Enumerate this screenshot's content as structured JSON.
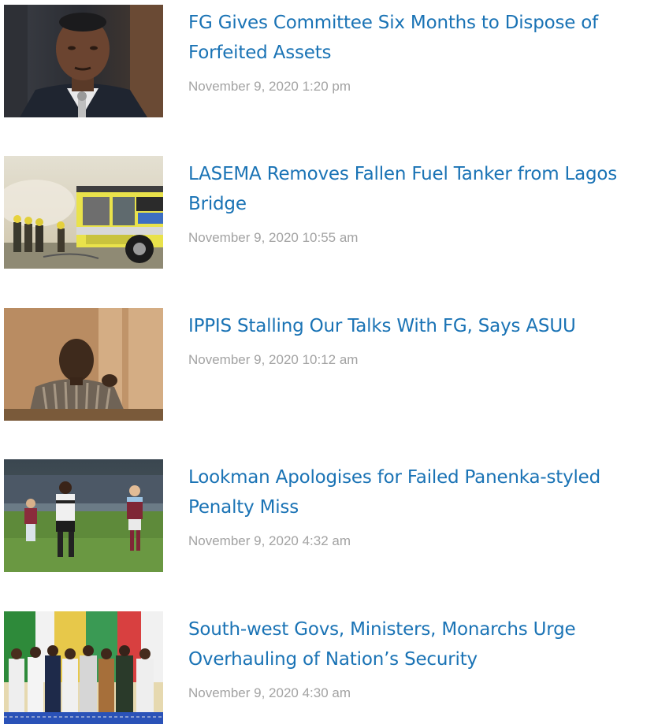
{
  "articles": [
    {
      "title": "FG Gives Committee Six Months to Dispose of Forfeited Assets",
      "date": "November 9, 2020 1:20 pm",
      "thumbnail": "official-at-press-briefing"
    },
    {
      "title": "LASEMA Removes Fallen Fuel Tanker from Lagos Bridge",
      "date": "November 9, 2020 10:55 am",
      "thumbnail": "fire-truck-and-firefighters"
    },
    {
      "title": "IPPIS Stalling Our Talks With FG, Says ASUU",
      "date": "November 9, 2020 10:12 am",
      "thumbnail": "man-seated-at-desk"
    },
    {
      "title": "Lookman Apologises for Failed Panenka-styled Penalty Miss",
      "date": "November 9, 2020 4:32 am",
      "thumbnail": "football-players-on-pitch"
    },
    {
      "title": "South-west Govs, Ministers, Monarchs Urge Overhauling of Nation’s Security",
      "date": "November 9, 2020 4:30 am",
      "thumbnail": "officials-standing-at-event"
    }
  ],
  "colors": {
    "headline": "#1a73b5",
    "timestamp": "#a3a3a3",
    "background": "#ffffff"
  }
}
